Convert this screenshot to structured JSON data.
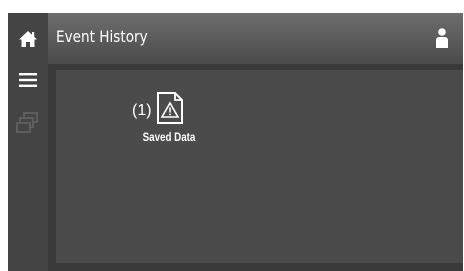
{
  "header": {
    "title": "Event History",
    "home_icon": "home-icon",
    "user_icon": "user-icon"
  },
  "sidebar": {
    "items": [
      {
        "icon": "menu-icon"
      },
      {
        "icon": "stacked-boxes-icon"
      }
    ]
  },
  "main": {
    "tiles": [
      {
        "count": "(1)",
        "label": "Saved Data",
        "icon": "document-warning-icon"
      }
    ]
  },
  "colors": {
    "topbar": "#5a5a5a",
    "sidebar": "#444444",
    "content": "#4b4b4b",
    "frame": "#3a3a3a",
    "text": "#ffffff",
    "disabled_icon": "#5e5e5e"
  }
}
